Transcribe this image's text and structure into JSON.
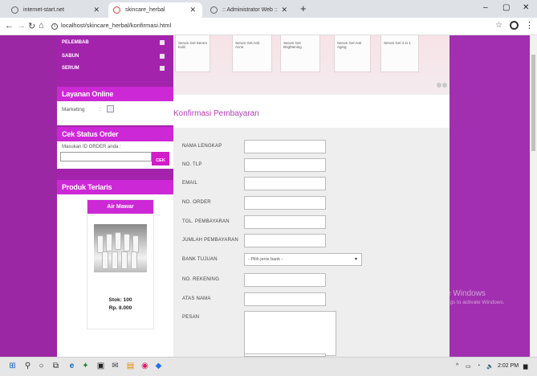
{
  "browser": {
    "tabs": [
      {
        "title": "internet-start.net",
        "active": false
      },
      {
        "title": "skincare_herbal",
        "active": true
      },
      {
        "title": ":: Administrator Web ::",
        "active": false
      }
    ],
    "new_tab": "+",
    "url": "localhost/skincare_herbal/konfirmasi.html",
    "window_controls": {
      "minimize": "–",
      "maximize": "▢",
      "close": "✕"
    }
  },
  "sidebar": {
    "menu": [
      {
        "label": "PELEMBAB"
      },
      {
        "label": "SABUN"
      },
      {
        "label": "SERUM"
      }
    ],
    "online_service": {
      "title": "Layanan Online",
      "label": "Marketing",
      "separator": ":"
    },
    "order_status": {
      "title": "Cek Status Order",
      "prompt": "Masukan ID ORDER anda :",
      "button": "CEK"
    },
    "best_products": {
      "title": "Produk Terlaris",
      "product": {
        "name": "Air Mawar",
        "stock": "Stok: 100",
        "price": "Rp. 8.000"
      }
    }
  },
  "banner": {
    "packs": [
      "Serum Gel Serum Kulit",
      "Serum Gel Anti Acne",
      "Serum Gel Brightening",
      "Serum Gel Anti Aging",
      "Serum Gel 4 in 1"
    ]
  },
  "main": {
    "title": "Konfirmasi Pembayaran",
    "form": {
      "nama": "NAMA LENGKAP",
      "tlp": "NO. TLP",
      "email": "EMAIL",
      "order": "NO. ORDER",
      "tgl": "TGL. PEMBAYARAN",
      "jumlah": "JUMLAH PEMBAYARAN",
      "bank": "BANK TUJUAN",
      "bank_placeholder": "- Pilih jenis bank -",
      "rekening": "NO. REKENING",
      "atas_nama": "ATAS NAMA",
      "pesan": "PESAN"
    }
  },
  "watermark": {
    "line1": "Activate Windows",
    "line2": "Go to Settings to activate Windows."
  },
  "taskbar": {
    "time": "2:02 PM"
  }
}
